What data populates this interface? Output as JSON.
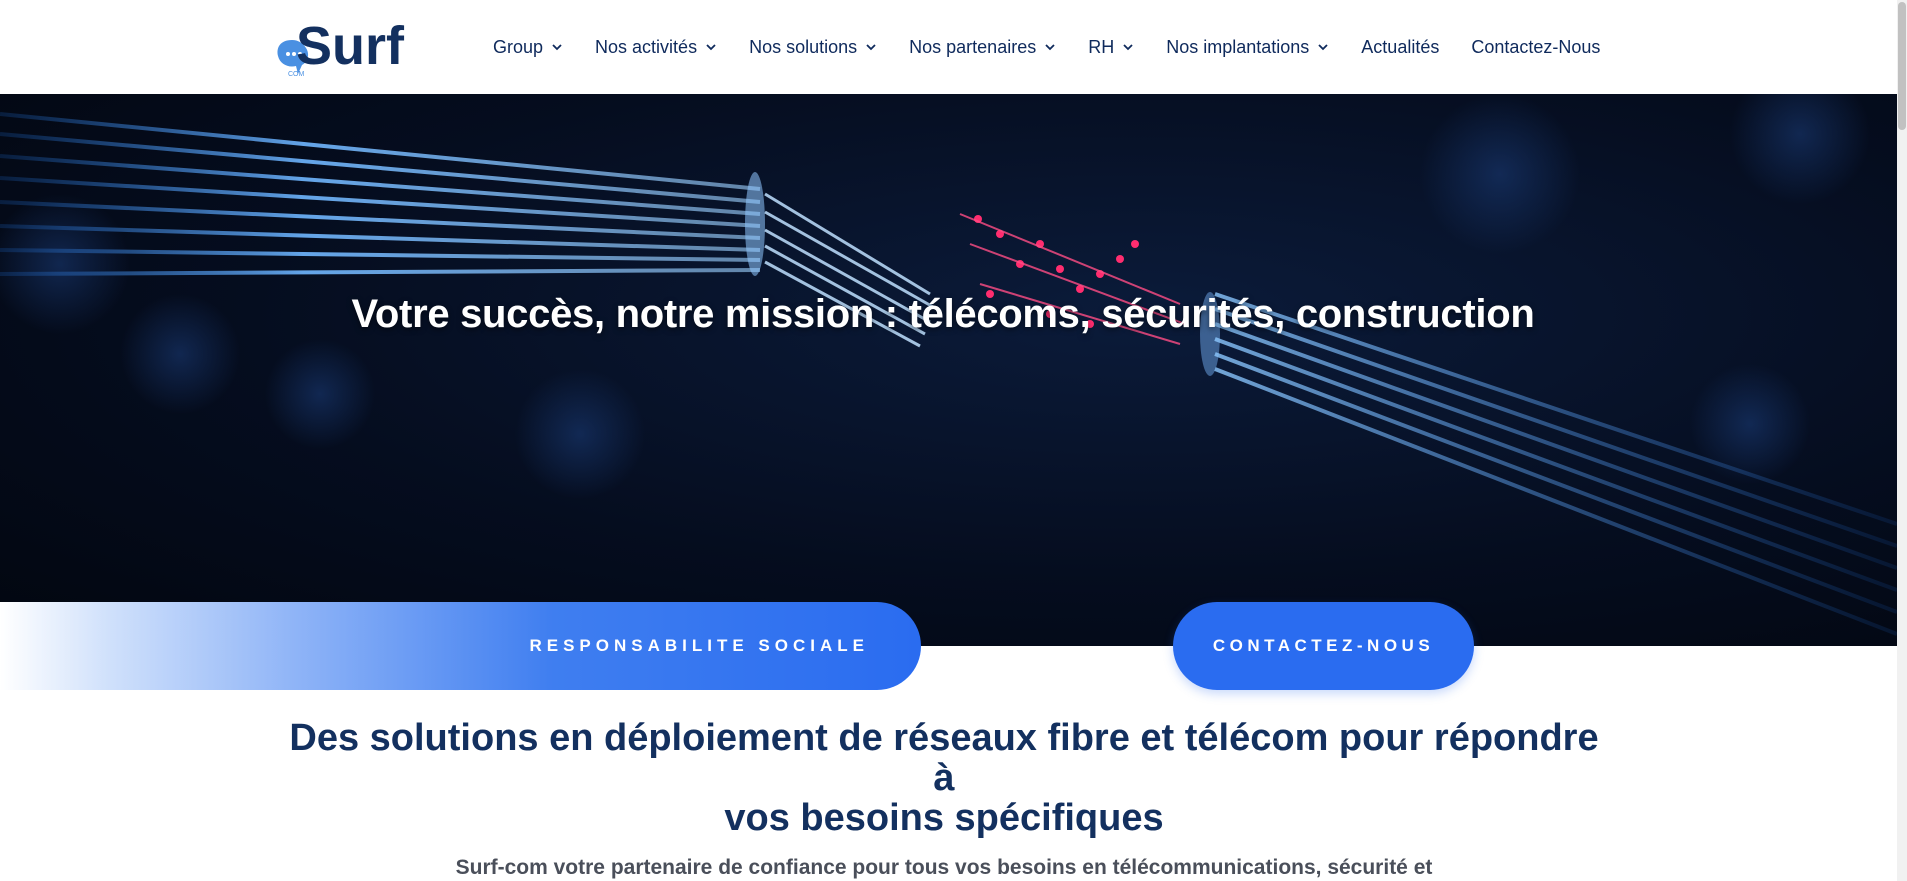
{
  "brand": {
    "logo_text": "Surf",
    "logo_sub": "COM",
    "colors": {
      "navy": "#13305f",
      "accent": "#2a6cf0",
      "light_accent": "#4a90e2"
    }
  },
  "nav": {
    "items": [
      {
        "label": "Group",
        "has_dropdown": true
      },
      {
        "label": "Nos activités",
        "has_dropdown": true
      },
      {
        "label": "Nos solutions",
        "has_dropdown": true
      },
      {
        "label": "Nos partenaires",
        "has_dropdown": true
      },
      {
        "label": "RH",
        "has_dropdown": true
      },
      {
        "label": "Nos implantations",
        "has_dropdown": true
      },
      {
        "label": "Actualités",
        "has_dropdown": false
      },
      {
        "label": "Contactez-Nous",
        "has_dropdown": false
      }
    ],
    "dropdown_icon": "chevron-down-icon"
  },
  "hero": {
    "title": "Votre succès, notre mission : télécoms, sécurités, construction",
    "image": "fiber-optic-cable"
  },
  "buttons": {
    "social": "RESPONSABILITE SOCIALE",
    "contact": "CONTACTEZ-NOUS"
  },
  "section": {
    "title_line1": "Des solutions en déploiement de réseaux fibre et télécom pour répondre à",
    "title_line2": "vos besoins spécifiques",
    "intro": "Surf-com votre partenaire de confiance pour tous vos besoins en télécommunications, sécurité et"
  }
}
